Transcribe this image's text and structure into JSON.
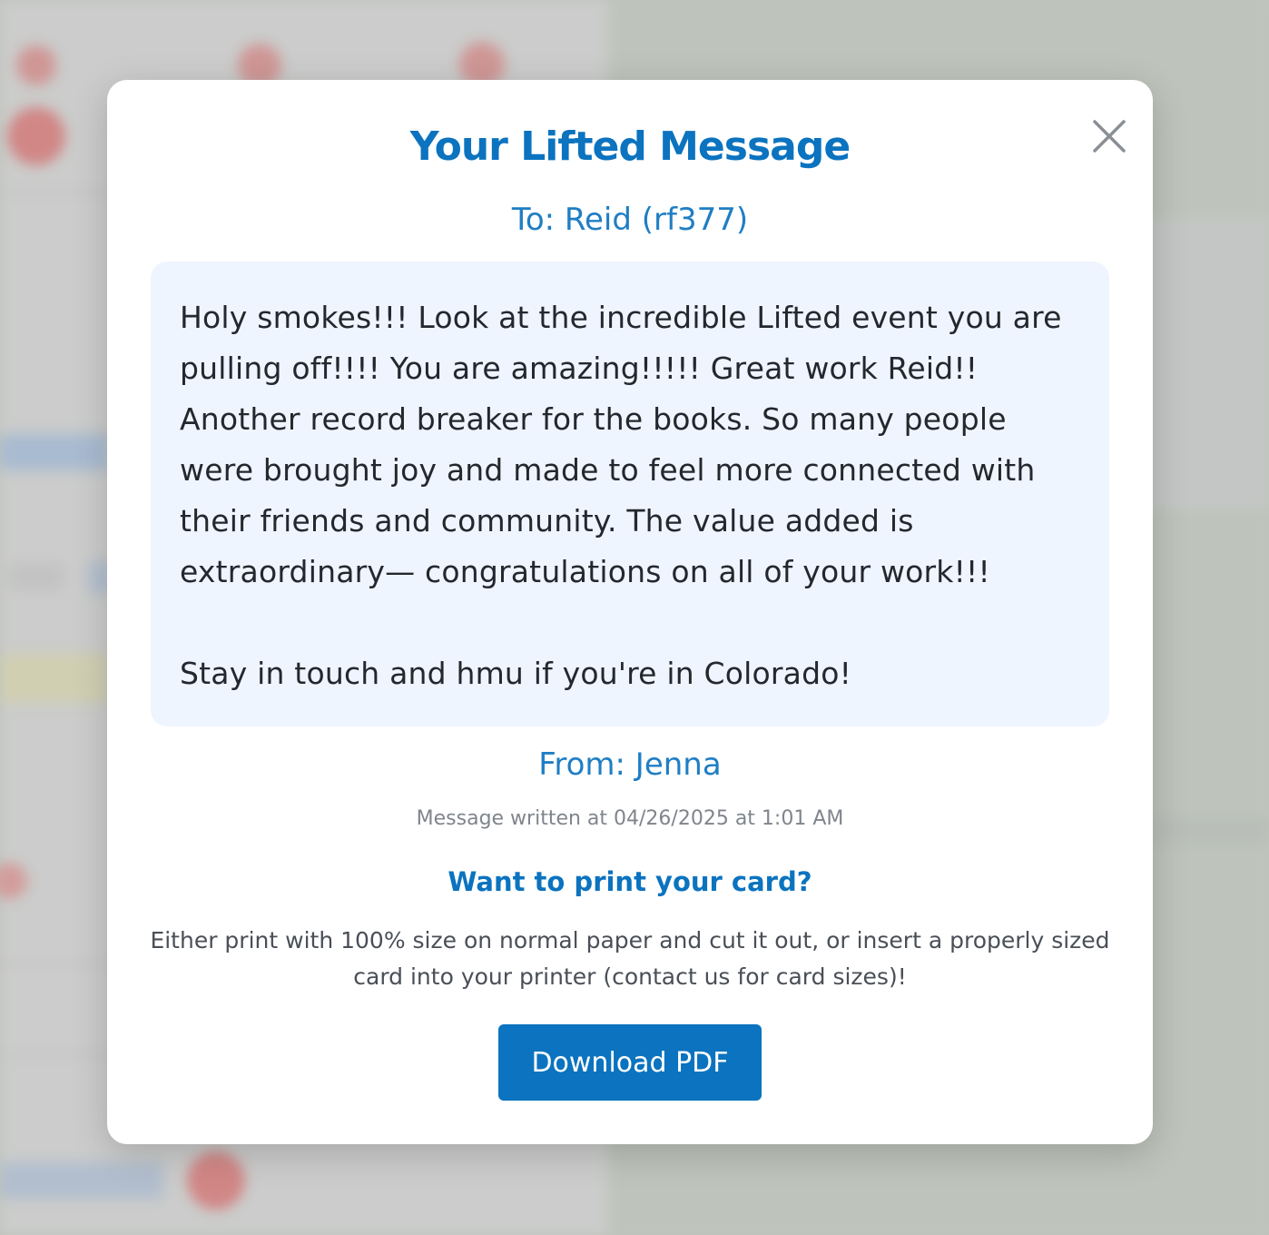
{
  "modal": {
    "title": "Your Lifted Message",
    "to_line": "To: Reid (rf377)",
    "message": "Holy smokes!!! Look at the incredible Lifted event you are pulling off!!!! You are amazing!!!!! Great work Reid!! Another record breaker for the books. So many people were brought joy and made to feel more connected with their friends and community. The value added is extraordinary— congratulations on all of your work!!!\n\nStay in touch and hmu if you're in Colorado!",
    "from_line": "From: Jenna",
    "timestamp": "Message written at 04/26/2025 at 1:01 AM",
    "print_heading": "Want to print your card?",
    "print_instructions": "Either print with 100% size on normal paper and cut it out, or insert a properly sized card into your printer (contact us for card sizes)!",
    "download_label": "Download PDF",
    "close_icon": "close-icon"
  },
  "colors": {
    "accent": "#0b73bf",
    "message_bg": "#eff5fe",
    "text_dark": "#23282f",
    "text_muted": "#80858c"
  }
}
